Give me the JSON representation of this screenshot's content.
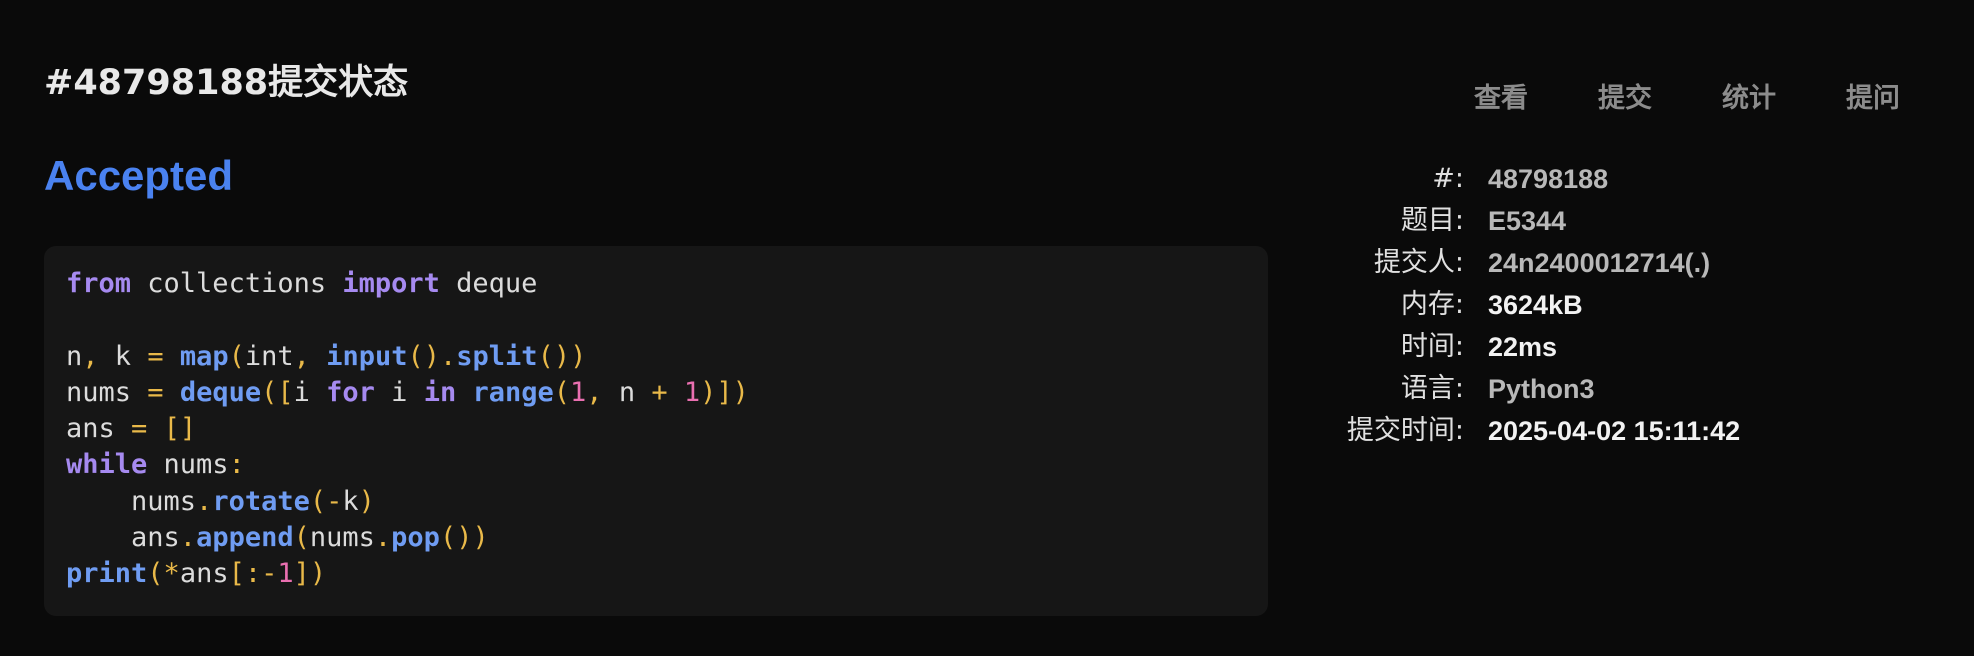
{
  "header": {
    "title": "#48798188提交状态",
    "nav": [
      "查看",
      "提交",
      "统计",
      "提问"
    ]
  },
  "submission": {
    "status": "Accepted",
    "status_color": "#4a82f0",
    "code_lines": [
      "from collections import deque",
      "",
      "n, k = map(int, input().split())",
      "nums = deque([i for i in range(1, n + 1)])",
      "ans = []",
      "while nums:",
      "    nums.rotate(-k)",
      "    ans.append(nums.pop())",
      "print(*ans[:-1])"
    ]
  },
  "details": {
    "id_label": "#:",
    "id_value": "48798188",
    "problem_label": "题目:",
    "problem_value": "E5344",
    "submitter_label": "提交人:",
    "submitter_value": "24n2400012714(.)",
    "memory_label": "内存:",
    "memory_value": "3624kB",
    "time_label": "时间:",
    "time_value": "22ms",
    "language_label": "语言:",
    "language_value": "Python3",
    "submit_time_label": "提交时间:",
    "submit_time_value": "2025-04-02 15:11:42"
  },
  "colors": {
    "background": "#0a0a0a",
    "code_background": "#161616",
    "keyword": "#a68af0",
    "function": "#6f9cf2",
    "punctuation": "#e9b949",
    "number": "#e96fb0"
  }
}
